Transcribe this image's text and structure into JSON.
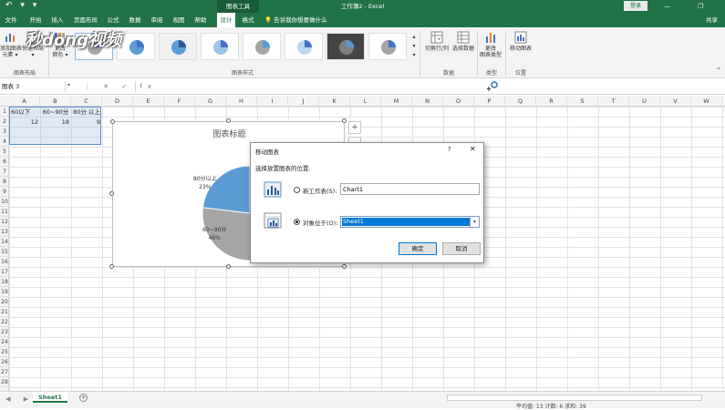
{
  "titlebar": {
    "qat": "↶ ▾ ▾",
    "context_tab": "图表工具",
    "window_title": "工作簿2 - Excel",
    "login": "登录",
    "window_buttons": "— ❐ ✕"
  },
  "tabs": [
    "文件",
    "开始",
    "插入",
    "页面布局",
    "公式",
    "数据",
    "审阅",
    "视图",
    "帮助",
    "设计",
    "格式"
  ],
  "tell_me": "告诉我你想要做什么",
  "share": "共享",
  "ribbon": {
    "add_element": "添加图表\n元素 ▾",
    "quick_layout": "快速布局\n▾",
    "change_colors": "更改\n颜色 ▾",
    "switch_row_col": "切换行/列",
    "select_data": "选择数据",
    "change_type": "更改\n图表类型",
    "move_chart": "移动图表",
    "groups": {
      "layout": "图表布局",
      "styles": "图表样式",
      "data": "数据",
      "type": "类型",
      "location": "位置"
    }
  },
  "watermark": "秒dong视频",
  "name_box": "图表 3",
  "formula_icons": "⋮ ✕ ✓ fx",
  "columns": [
    "A",
    "B",
    "C",
    "D",
    "E",
    "F",
    "G",
    "H",
    "I",
    "J",
    "K",
    "L",
    "M",
    "N",
    "O",
    "P",
    "Q",
    "R",
    "S",
    "T",
    "U",
    "V",
    "W"
  ],
  "rows": [
    "1",
    "2",
    "3",
    "4",
    "5",
    "6",
    "7",
    "8",
    "9",
    "10",
    "11",
    "12",
    "13",
    "14",
    "15",
    "16",
    "17",
    "18",
    "19",
    "20",
    "21",
    "22",
    "23",
    "24",
    "25",
    "26",
    "27",
    "28"
  ],
  "cells": {
    "a1": "60以下",
    "b1": "60~90分",
    "c1": "80分 以上",
    "a2": "12",
    "b2": "18",
    "c2": "9"
  },
  "chart": {
    "title": "图表标题",
    "label_80": "80分以上",
    "pct_80": "23%",
    "label_60_90": "60~90分",
    "pct_60_90": "46%",
    "label_cut": "6"
  },
  "chart_data": {
    "type": "pie",
    "title": "图表标题",
    "categories": [
      "60以下",
      "60~90分",
      "80分 以上"
    ],
    "values": [
      12,
      18,
      9
    ],
    "percent_labels": [
      "",
      "46%",
      "23%"
    ],
    "colors": [
      "#4472c4",
      "#a5a5a5",
      "#5b9bd5"
    ]
  },
  "side_buttons": [
    "+",
    ""
  ],
  "dialog": {
    "title": "移动图表",
    "help": "?",
    "close": "✕",
    "prompt": "选择放置图表的位置:",
    "new_sheet_label": "新工作表(S):",
    "new_sheet_value": "Chart1",
    "object_in_label": "对象位于(O):",
    "object_in_value": "Sheet1",
    "ok": "确定",
    "cancel": "取消"
  },
  "sheet_tab": "Sheet1",
  "add_sheet": "+",
  "sheet_nav": "◀ ▶",
  "status": "平均值: 13  计数: 6  求和: 39"
}
